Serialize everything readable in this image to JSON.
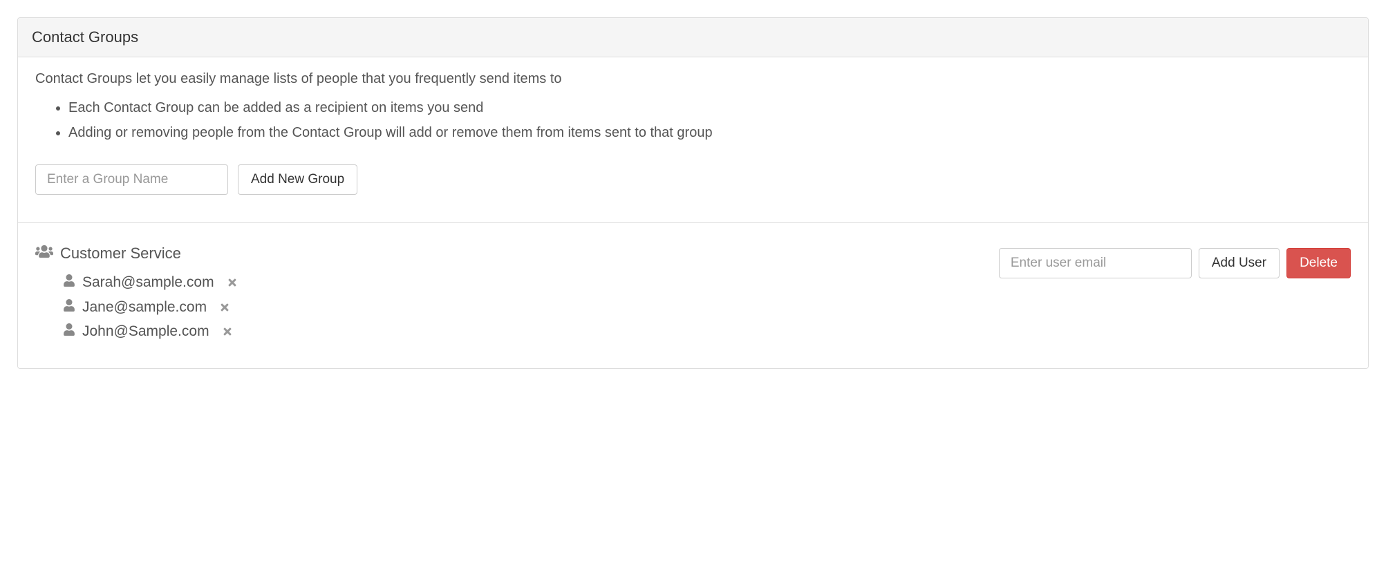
{
  "header": {
    "title": "Contact Groups"
  },
  "intro": {
    "text": "Contact Groups let you easily manage lists of people that you frequently send items to",
    "bullets": [
      "Each Contact Group can be added as a recipient on items you send",
      "Adding or removing people from the Contact Group will add or remove them from items sent to that group"
    ]
  },
  "newGroupForm": {
    "placeholder": "Enter a Group Name",
    "button": "Add New Group"
  },
  "group": {
    "name": "Customer Service",
    "members": [
      "Sarah@sample.com",
      "Jane@sample.com",
      "John@Sample.com"
    ],
    "emailPlaceholder": "Enter user email",
    "addUserButton": "Add User",
    "deleteButton": "Delete"
  }
}
